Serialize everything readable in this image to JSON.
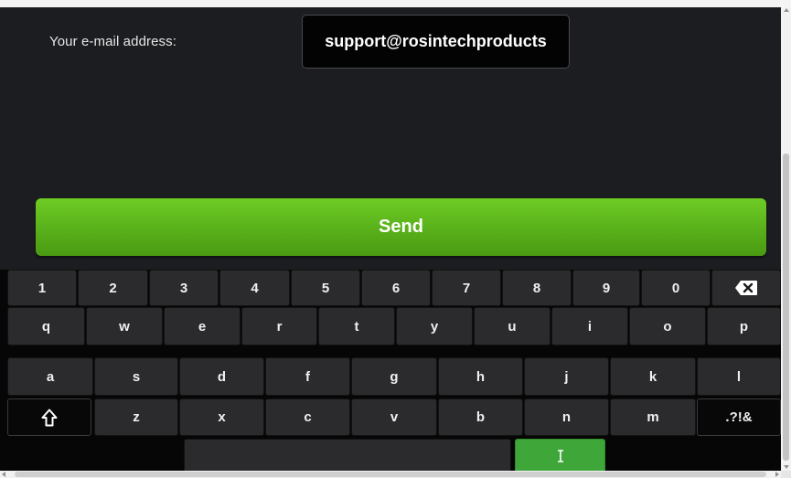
{
  "form": {
    "email_label": "Your e-mail address:",
    "email_value": "support@rosintechproducts"
  },
  "send_button": {
    "label": "Send"
  },
  "keyboard": {
    "row1": [
      "1",
      "2",
      "3",
      "4",
      "5",
      "6",
      "7",
      "8",
      "9",
      "0"
    ],
    "row2": [
      "q",
      "w",
      "e",
      "r",
      "t",
      "y",
      "u",
      "i",
      "o",
      "p"
    ],
    "row3": [
      "a",
      "s",
      "d",
      "f",
      "g",
      "h",
      "j",
      "k",
      "l"
    ],
    "row4": [
      "z",
      "x",
      "c",
      "v",
      "b",
      "n",
      "m"
    ],
    "symbols_label": ".?!&",
    "shift_icon": "shift-arrow-icon",
    "backspace_icon": "backspace-icon",
    "cursor_icon": "text-cursor-icon",
    "space_label": ""
  },
  "colors": {
    "background": "#1c1d20",
    "accent_green": "#5cb51c",
    "key_bg": "#2b2b2e"
  }
}
